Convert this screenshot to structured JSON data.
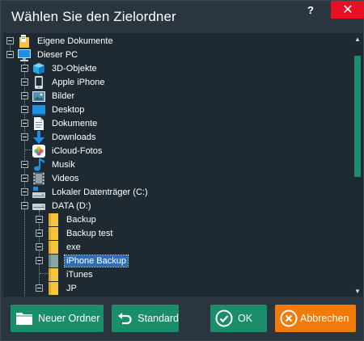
{
  "window": {
    "title": "Wählen Sie den Zielordner",
    "help_label": "?",
    "close_label": "✕"
  },
  "tree": {
    "items": [
      {
        "label": "Eigene Dokumente",
        "icon": "documents-folder-icon",
        "level": 0
      },
      {
        "label": "Dieser PC",
        "icon": "computer-icon",
        "level": 0
      },
      {
        "label": "3D-Objekte",
        "icon": "3d-objects-icon",
        "level": 1
      },
      {
        "label": "Apple iPhone",
        "icon": "phone-icon",
        "level": 1
      },
      {
        "label": "Bilder",
        "icon": "pictures-icon",
        "level": 1
      },
      {
        "label": "Desktop",
        "icon": "desktop-icon",
        "level": 1
      },
      {
        "label": "Dokumente",
        "icon": "document-icon",
        "level": 1
      },
      {
        "label": "Downloads",
        "icon": "download-icon",
        "level": 1
      },
      {
        "label": "iCloud-Fotos",
        "icon": "icloud-photos-icon",
        "level": 1
      },
      {
        "label": "Musik",
        "icon": "music-icon",
        "level": 1
      },
      {
        "label": "Videos",
        "icon": "video-icon",
        "level": 1
      },
      {
        "label": "Lokaler Datenträger (C:)",
        "icon": "drive-c-icon",
        "level": 1
      },
      {
        "label": "DATA (D:)",
        "icon": "drive-icon",
        "level": 1
      },
      {
        "label": "Backup",
        "icon": "folder-icon",
        "level": 2
      },
      {
        "label": "Backup test",
        "icon": "folder-icon",
        "level": 2
      },
      {
        "label": "exe",
        "icon": "folder-icon",
        "level": 2
      },
      {
        "label": "iPhone Backup",
        "icon": "folder-selected-icon",
        "level": 2,
        "selected": true
      },
      {
        "label": "iTunes",
        "icon": "folder-icon",
        "level": 2
      },
      {
        "label": "JP",
        "icon": "folder-icon",
        "level": 2
      }
    ]
  },
  "buttons": {
    "new_folder": "Neuer Ordner",
    "default": "Standard",
    "ok": "OK",
    "cancel": "Abbrechen"
  },
  "colors": {
    "background": "#2b3540",
    "tree_background": "#1f2932",
    "accent_green": "#1c8d6a",
    "accent_orange": "#f07a0a",
    "selection": "#2a6fb8",
    "close_red": "#e81123"
  }
}
